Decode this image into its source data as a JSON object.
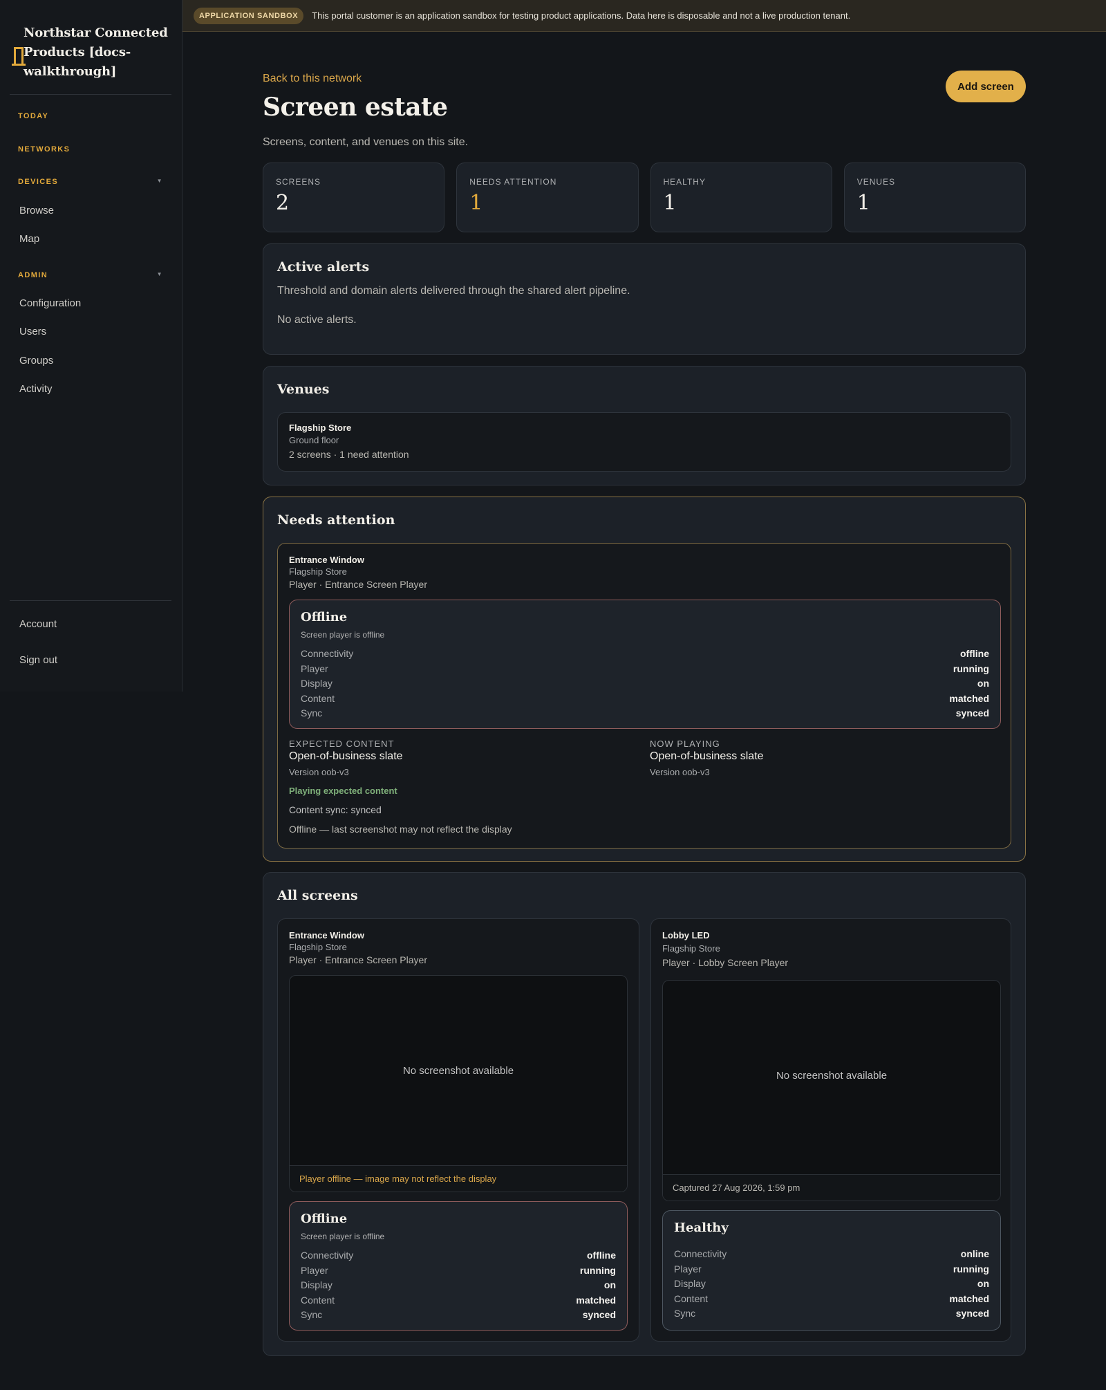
{
  "sidebar": {
    "brand": "Northstar Connected Products [docs-walkthrough]",
    "sections": [
      {
        "label": "TODAY"
      },
      {
        "label": "NETWORKS"
      },
      {
        "label": "DEVICES",
        "items": [
          "Browse",
          "Map"
        ]
      },
      {
        "label": "ADMIN",
        "items": [
          "Configuration",
          "Users",
          "Groups",
          "Activity"
        ]
      }
    ],
    "footer": [
      "Account",
      "Sign out"
    ]
  },
  "banner": {
    "tag": "APPLICATION SANDBOX",
    "message": "This portal customer is an application sandbox for testing product applications. Data here is disposable and not a live production tenant."
  },
  "header": {
    "back": "Back to this network",
    "title": "Screen estate",
    "subtitle": "Screens, content, and venues on this site.",
    "add_button": "Add screen"
  },
  "stats": [
    {
      "label": "SCREENS",
      "value": "2"
    },
    {
      "label": "NEEDS ATTENTION",
      "value": "1"
    },
    {
      "label": "HEALTHY",
      "value": "1"
    },
    {
      "label": "VENUES",
      "value": "1"
    }
  ],
  "alerts": {
    "title": "Active alerts",
    "description": "Threshold and domain alerts delivered through the shared alert pipeline.",
    "empty": "No active alerts."
  },
  "venues": {
    "title": "Venues",
    "items": [
      {
        "name": "Flagship Store",
        "floor": "Ground floor",
        "summary": "2 screens · 1 need attention"
      }
    ]
  },
  "needs_attention": {
    "title": "Needs attention",
    "screen": {
      "name": "Entrance Window",
      "venue": "Flagship Store",
      "player": "Player · Entrance Screen Player",
      "status": {
        "title": "Offline",
        "sub": "Screen player is offline",
        "rows": [
          {
            "k": "Connectivity",
            "v": "offline"
          },
          {
            "k": "Player",
            "v": "running"
          },
          {
            "k": "Display",
            "v": "on"
          },
          {
            "k": "Content",
            "v": "matched"
          },
          {
            "k": "Sync",
            "v": "synced"
          }
        ]
      },
      "expected_label": "EXPECTED CONTENT",
      "expected_title": "Open-of-business slate",
      "expected_version": "Version oob-v3",
      "now_label": "NOW PLAYING",
      "now_title": "Open-of-business slate",
      "now_version": "Version oob-v3",
      "playing_status": "Playing expected content",
      "sync_line": "Content sync: synced",
      "offline_note": "Offline — last screenshot may not reflect the display"
    }
  },
  "all_screens": {
    "title": "All screens",
    "screens": [
      {
        "name": "Entrance Window",
        "venue": "Flagship Store",
        "player": "Player · Entrance Screen Player",
        "no_shot": "No screenshot available",
        "foot": "Player offline — image may not reflect the display",
        "status": {
          "title": "Offline",
          "sub": "Screen player is offline",
          "rows": [
            {
              "k": "Connectivity",
              "v": "offline"
            },
            {
              "k": "Player",
              "v": "running"
            },
            {
              "k": "Display",
              "v": "on"
            },
            {
              "k": "Content",
              "v": "matched"
            },
            {
              "k": "Sync",
              "v": "synced"
            }
          ]
        }
      },
      {
        "name": "Lobby LED",
        "venue": "Flagship Store",
        "player": "Player · Lobby Screen Player",
        "no_shot": "No screenshot available",
        "foot": "Captured 27 Aug 2026, 1:59 pm",
        "status": {
          "title": "Healthy",
          "rows": [
            {
              "k": "Connectivity",
              "v": "online"
            },
            {
              "k": "Player",
              "v": "running"
            },
            {
              "k": "Display",
              "v": "on"
            },
            {
              "k": "Content",
              "v": "matched"
            },
            {
              "k": "Sync",
              "v": "synced"
            }
          ]
        }
      }
    ]
  }
}
